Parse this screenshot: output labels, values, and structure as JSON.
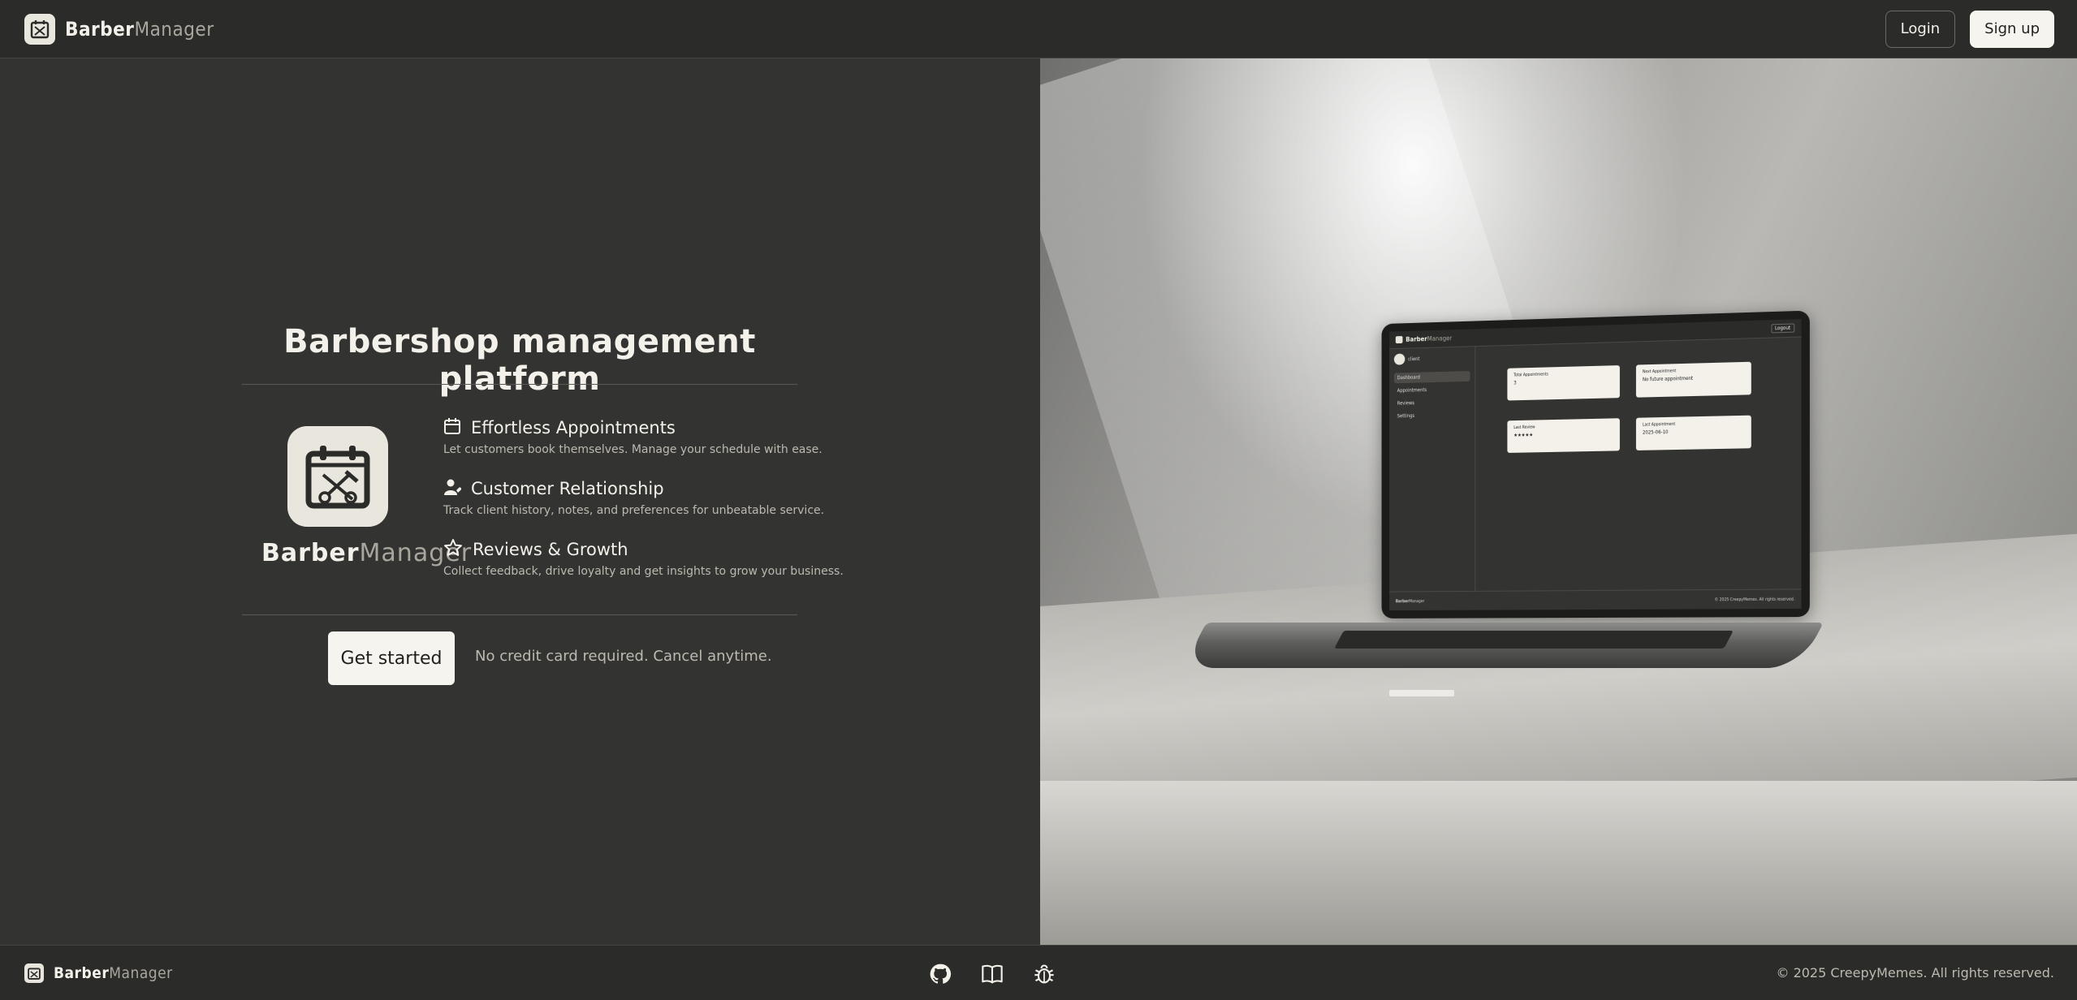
{
  "header": {
    "brand_bold": "Barber",
    "brand_light": "Manager",
    "login_label": "Login",
    "signup_label": "Sign up"
  },
  "hero": {
    "title": "Barbershop management platform",
    "brand_bold": "Barber",
    "brand_light": "Manager",
    "features": [
      {
        "icon": "calendar-icon",
        "title": "Effortless Appointments",
        "desc": "Let customers book themselves. Manage your schedule with ease."
      },
      {
        "icon": "user-heart-icon",
        "title": "Customer Relationship",
        "desc": "Track client history, notes, and preferences for unbeatable service."
      },
      {
        "icon": "star-icon",
        "title": "Reviews & Growth",
        "desc": "Collect feedback, drive loyalty and get insights to grow your business."
      }
    ],
    "cta_label": "Get started",
    "cta_note": "No credit card required. Cancel anytime."
  },
  "laptop_screen": {
    "brand_bold": "Barber",
    "brand_light": "Manager",
    "logout_label": "Logout",
    "user_name": "client",
    "nav": [
      "Dashboard",
      "Appointments",
      "Reviews",
      "Settings"
    ],
    "cards": [
      {
        "title": "Total Appointments",
        "value": "3"
      },
      {
        "title": "Next Appointment",
        "value": "No future appointment"
      },
      {
        "title": "Last Review",
        "value": "★★★★★"
      },
      {
        "title": "Last Appointment",
        "value": "2025-06-10"
      }
    ],
    "footer_note": "© 2025 CreepyMemes. All rights reserved."
  },
  "footer": {
    "brand_bold": "Barber",
    "brand_light": "Manager",
    "icons": [
      "github-icon",
      "book-icon",
      "bug-icon"
    ],
    "copyright": "© 2025 CreepyMemes. All rights reserved."
  },
  "colors": {
    "background": "#333331",
    "bar": "#2b2b29",
    "accent_light": "#f6f4ee",
    "muted_text": "#a9a69d"
  }
}
